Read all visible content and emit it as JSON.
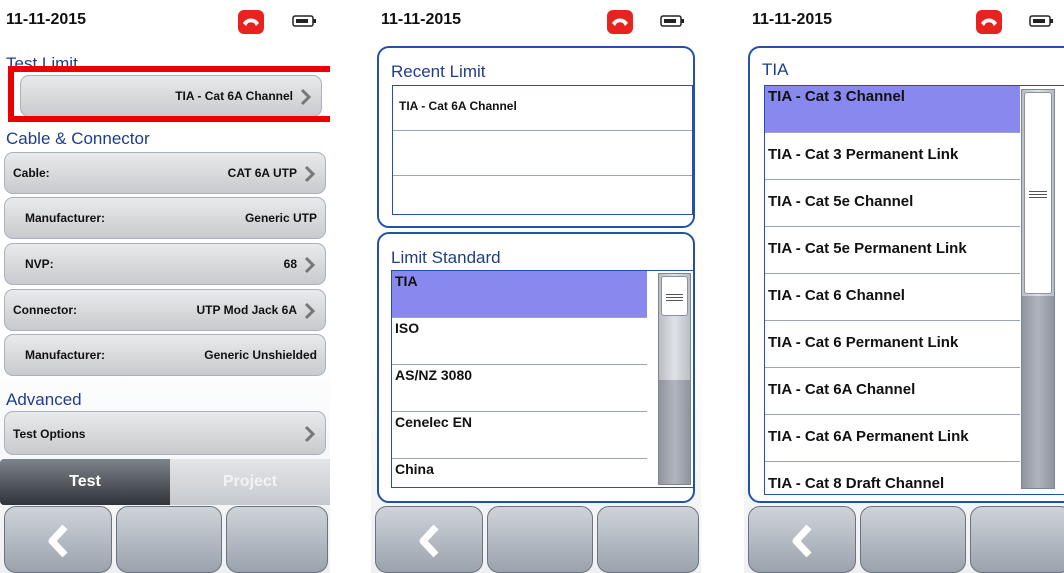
{
  "screens": [
    {
      "date": "11-11-2015",
      "test_limit": {
        "title": "Test Limit",
        "value": "TIA - Cat 6A Channel"
      },
      "cable_connector": {
        "title": "Cable & Connector",
        "rows": [
          {
            "label": "Cable:",
            "value": "CAT 6A UTP",
            "chevron": true
          },
          {
            "label": "Manufacturer:",
            "value": "Generic UTP",
            "chevron": false
          },
          {
            "label": "NVP:",
            "value": "68",
            "chevron": true
          },
          {
            "label": "Connector:",
            "value": "UTP Mod Jack 6A",
            "chevron": true
          },
          {
            "label": "Manufacturer:",
            "value": "Generic Unshielded",
            "chevron": false
          }
        ]
      },
      "advanced": {
        "title": "Advanced",
        "test_options": "Test Options"
      },
      "tabs": [
        {
          "label": "Test",
          "active": true
        },
        {
          "label": "Project",
          "active": false
        }
      ],
      "highlight_color": "#ee0000"
    },
    {
      "date": "11-11-2015",
      "recent_limit": {
        "title": "Recent Limit",
        "items": [
          "TIA - Cat 6A Channel",
          ""
        ]
      },
      "limit_standard": {
        "title": "Limit Standard",
        "items": [
          "TIA",
          "ISO",
          "AS/NZ 3080",
          "Cenelec EN",
          "China"
        ],
        "selected_index": 0
      }
    },
    {
      "date": "11-11-2015",
      "tia": {
        "title": "TIA",
        "items": [
          "TIA - Cat 3 Channel",
          "TIA - Cat 3 Permanent Link",
          "TIA - Cat 5e Channel",
          "TIA - Cat 5e Permanent Link",
          "TIA - Cat 6 Channel",
          "TIA - Cat 6 Permanent Link",
          "TIA - Cat 6A Channel",
          "TIA - Cat 6A Permanent Link",
          "TIA - Cat 8 Draft Channel"
        ],
        "selected_index": 0
      }
    }
  ],
  "colors": {
    "accent": "#2451a8",
    "selection": "#8888ee",
    "phone": "#e8231f"
  },
  "icons": [
    "phone-icon",
    "battery-icon",
    "chevron-right-icon",
    "back-arrow-icon",
    "scroll-grip-icon"
  ]
}
